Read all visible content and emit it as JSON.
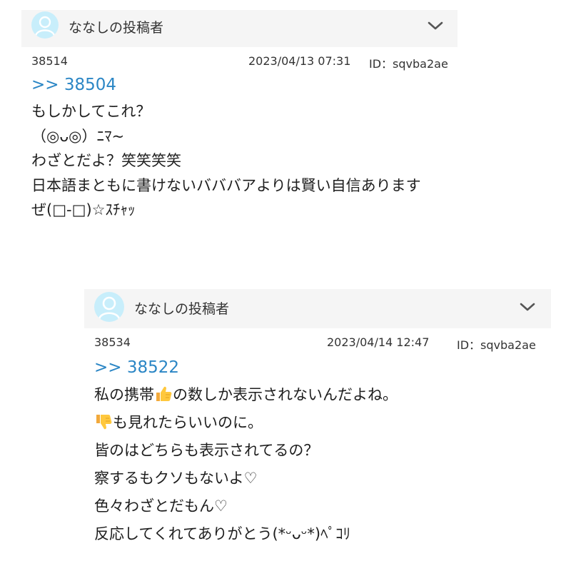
{
  "post1": {
    "poster_name": "ななしの投稿者",
    "number": "38514",
    "datetime": "2023/04/13 07:31",
    "id_text": "ID：sqvba2ae",
    "reply_to": ">> 38504",
    "lines": [
      "もしかしてこれ？",
      "（◎ᴗ◎）ﾆﾏ~",
      "",
      "わざとだよ？笑笑笑笑",
      "",
      "日本語まともに書けないバババアよりは賢い自信あります",
      "ぜ(□-□)☆ｽﾁｬｯ"
    ]
  },
  "post2": {
    "poster_name": "ななしの投稿者",
    "number": "38534",
    "datetime": "2023/04/14 12:47",
    "id_text": "ID：sqvba2ae",
    "reply_to": ">> 38522",
    "line1_before": "私の携帯",
    "line1_after": "の数しか表示されないんだよね。",
    "line2_after": "も見れたらいいのに。",
    "lines_rest": [
      "皆のはどちらも表示されてるの？",
      "察するもクソもないよ♡",
      "色々わざとだもん♡",
      "反応してくれてありがとう(*ᵕᴗᵕ*)ﾍﾟｺﾘ"
    ],
    "emoji_names": [
      "thumbs-up-icon",
      "thumbs-down-icon"
    ]
  },
  "colors": {
    "header_bg": "#f5f5f5",
    "avatar_bg": "#c8eefb",
    "link": "#2b86c5"
  }
}
